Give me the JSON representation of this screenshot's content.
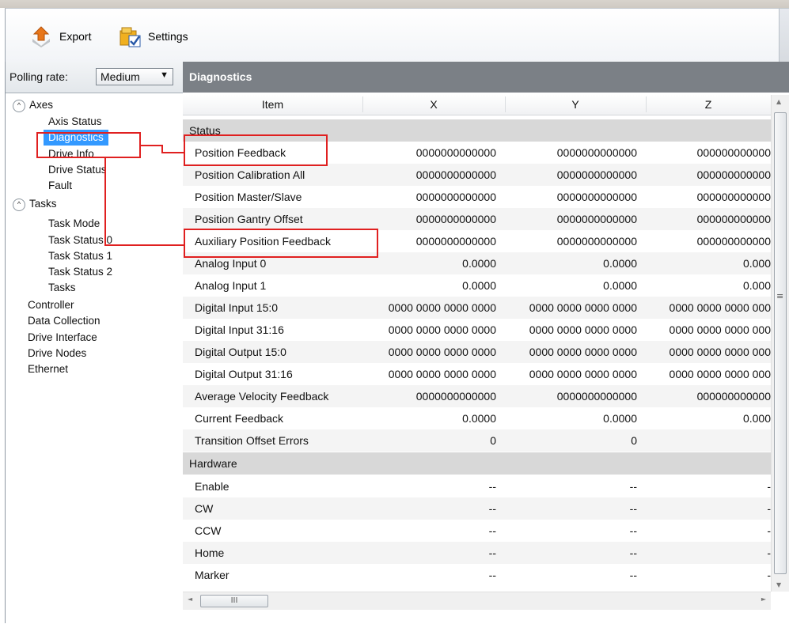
{
  "toolbar": {
    "export_label": "Export",
    "settings_label": "Settings"
  },
  "polling": {
    "label": "Polling rate:",
    "value": "Medium"
  },
  "tree": {
    "axes_label": "Axes",
    "axes_items": [
      "Axis Status",
      "Diagnostics",
      "Drive Info",
      "Drive Status",
      "Fault"
    ],
    "tasks_label": "Tasks",
    "tasks_items": [
      "Task Mode",
      "Task Status 0",
      "Task Status 1",
      "Task Status 2",
      "Tasks"
    ],
    "root_items": [
      "Controller",
      "Data Collection",
      "Drive Interface",
      "Drive Nodes",
      "Ethernet"
    ],
    "selected": "Diagnostics"
  },
  "panel": {
    "title": "Diagnostics"
  },
  "grid": {
    "columns": [
      "Item",
      "X",
      "Y",
      "Z"
    ],
    "status_group": "Status",
    "status_rows": [
      {
        "item": "Position Feedback",
        "x": "0000000000000",
        "y": "0000000000000",
        "z": "000000000000"
      },
      {
        "item": "Position Calibration All",
        "x": "0000000000000",
        "y": "0000000000000",
        "z": "000000000000"
      },
      {
        "item": "Position Master/Slave",
        "x": "0000000000000",
        "y": "0000000000000",
        "z": "000000000000"
      },
      {
        "item": "Position Gantry Offset",
        "x": "0000000000000",
        "y": "0000000000000",
        "z": "000000000000"
      },
      {
        "item": "Auxiliary Position Feedback",
        "x": "0000000000000",
        "y": "0000000000000",
        "z": "000000000000"
      },
      {
        "item": "Analog Input 0",
        "x": "0.0000",
        "y": "0.0000",
        "z": "0.000"
      },
      {
        "item": "Analog Input 1",
        "x": "0.0000",
        "y": "0.0000",
        "z": "0.000"
      },
      {
        "item": "Digital Input 15:0",
        "x": "0000 0000 0000 0000",
        "y": "0000 0000 0000 0000",
        "z": "0000 0000 0000 000"
      },
      {
        "item": "Digital Input 31:16",
        "x": "0000 0000 0000 0000",
        "y": "0000 0000 0000 0000",
        "z": "0000 0000 0000 000"
      },
      {
        "item": "Digital Output 15:0",
        "x": "0000 0000 0000 0000",
        "y": "0000 0000 0000 0000",
        "z": "0000 0000 0000 000"
      },
      {
        "item": "Digital Output 31:16",
        "x": "0000 0000 0000 0000",
        "y": "0000 0000 0000 0000",
        "z": "0000 0000 0000 000"
      },
      {
        "item": "Average Velocity Feedback",
        "x": "0000000000000",
        "y": "0000000000000",
        "z": "000000000000"
      },
      {
        "item": "Current Feedback",
        "x": "0.0000",
        "y": "0.0000",
        "z": "0.000"
      },
      {
        "item": "Transition Offset Errors",
        "x": "0",
        "y": "0",
        "z": ""
      }
    ],
    "hardware_group": "Hardware",
    "hardware_rows": [
      {
        "item": "Enable",
        "x": "--",
        "y": "--",
        "z": "-"
      },
      {
        "item": "CW",
        "x": "--",
        "y": "--",
        "z": "-"
      },
      {
        "item": "CCW",
        "x": "--",
        "y": "--",
        "z": "-"
      },
      {
        "item": "Home",
        "x": "--",
        "y": "--",
        "z": "-"
      },
      {
        "item": "Marker",
        "x": "--",
        "y": "--",
        "z": "-"
      }
    ]
  },
  "scroll": {
    "h_thumb_glyph": "III",
    "v_thumb_glyph": "≡"
  },
  "colors": {
    "selection": "#3399ff",
    "header_bar": "#7b8086",
    "annotation": "#e02020",
    "group_row": "#d8d8d8"
  }
}
